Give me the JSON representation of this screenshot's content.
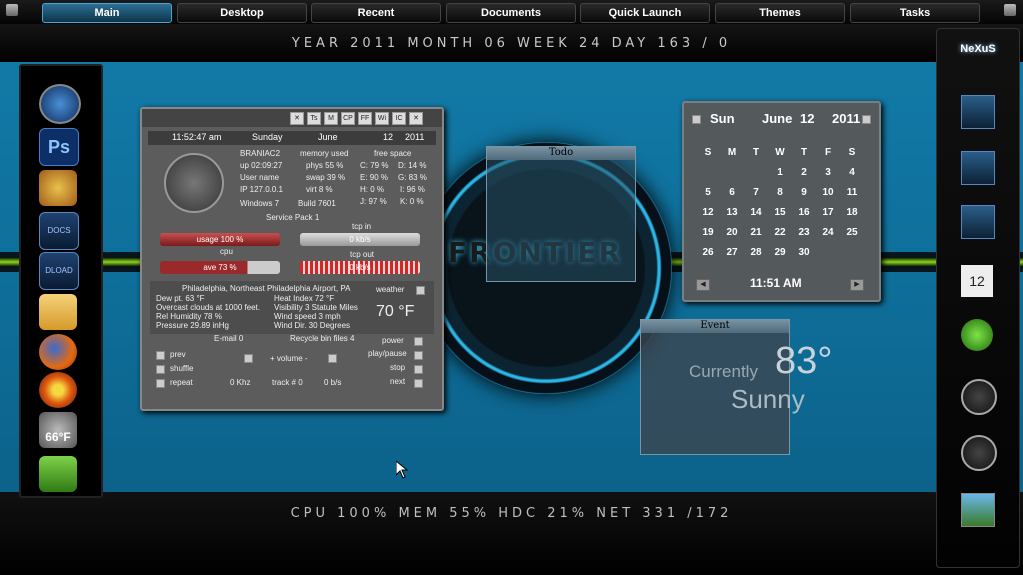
{
  "topbar": {
    "tabs": [
      "Main",
      "Desktop",
      "Recent",
      "Documents",
      "Quick Launch",
      "Themes",
      "Tasks"
    ]
  },
  "datestrip": {
    "text": "YEAR 2011   MONTH 06   WEEK 24   DAY 163 / 0"
  },
  "stats": {
    "text": "CPU 100% MEM 55%   HDC 21%   NET 331 /172"
  },
  "wallpaper": {
    "logo_text": "FRONTIER"
  },
  "leftdock": {
    "weather_temp": "66°F"
  },
  "rightdock": {
    "brand": "NeXuS"
  },
  "mainwidget": {
    "header_buttons": [
      "✕",
      "Ts",
      "M",
      "CP",
      "FF",
      "Wi",
      "IC",
      "✕"
    ],
    "time": "11:52:47 am",
    "weekday": "Sunday",
    "month": "June",
    "day": "12",
    "year": "2011",
    "sys": {
      "user_pc": "BRANIAC2",
      "uptime": "up 02:09:27",
      "username": "User name",
      "ip": "IP 127.0.0.1",
      "os": "Windows 7",
      "build": "Build 7601",
      "sp": "Service Pack 1"
    },
    "memory": {
      "title": "memory used",
      "phys": "phys 55 %",
      "swap": "swap 39 %",
      "virt": "virt 8 %"
    },
    "freespace": {
      "title": "free space",
      "c": "C: 79 %",
      "d": "D: 14 %",
      "e": "E: 90 %",
      "g": "G: 83 %",
      "h": "H: 0 %",
      "i": "I: 96 %",
      "j": "J: 97 %",
      "k": "K: 0 %"
    },
    "cpu_usage": "usage 100 %",
    "cpu_label": "cpu",
    "cpu_ave": "ave 73 %",
    "tcp_in_label": "tcp in",
    "tcp_in": "0 kb/s",
    "tcp_out_label": "tcp out",
    "tcp_out": "0 kb/s",
    "weather": {
      "location": "Philadelphia, Northeast Philadelphia Airport, PA",
      "weather_label": "weather",
      "dewpt": "Dew pt. 63 °F",
      "heat": "Heat Index 72 °F",
      "overcast": "Overcast clouds at 1000 feet.",
      "visibility": "Visibility 3 Statute Miles",
      "humidity": "Rel Humidity 78 %",
      "windspeed": "Wind speed 3 mph",
      "pressure": "Pressure 29.89 inHg",
      "winddir": "Wind Dir. 30 Degrees",
      "temp": "70 °F"
    },
    "email": "E-mail 0",
    "recycle": "Recycle bin files 4",
    "power": "power",
    "prev": "prev",
    "volume": "+  volume  -",
    "playpause": "play/pause",
    "shuffle": "shuffle",
    "stop": "stop",
    "repeat": "repeat",
    "khz": "0 Khz",
    "track": "track # 0",
    "bs": "0 b/s",
    "next": "next"
  },
  "todo": {
    "title": "Todo"
  },
  "event": {
    "title": "Event",
    "currently": "Currently",
    "temp": "83°",
    "condition": "Sunny"
  },
  "calendar": {
    "weekday": "Sun",
    "month": "June",
    "day": "12",
    "year": "2011",
    "dow": [
      "S",
      "M",
      "T",
      "W",
      "T",
      "F",
      "S"
    ],
    "weeks": [
      [
        "",
        "",
        "",
        "1",
        "2",
        "3",
        "4"
      ],
      [
        "5",
        "6",
        "7",
        "8",
        "9",
        "10",
        "11"
      ],
      [
        "12",
        "13",
        "14",
        "15",
        "16",
        "17",
        "18"
      ],
      [
        "19",
        "20",
        "21",
        "22",
        "23",
        "24",
        "25"
      ],
      [
        "26",
        "27",
        "28",
        "29",
        "30",
        "",
        ""
      ]
    ],
    "time": "11:51 AM"
  }
}
